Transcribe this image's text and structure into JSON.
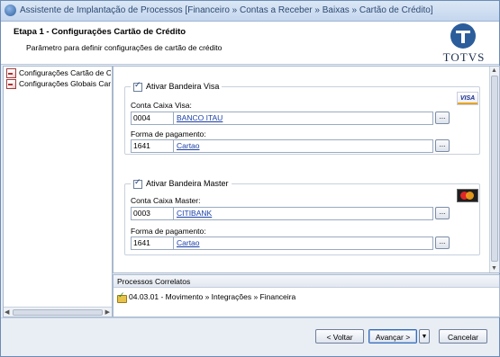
{
  "window": {
    "title": "Assistente de Implantação de Processos [Financeiro » Contas a Receber » Baixas » Cartão de Crédito]"
  },
  "header": {
    "step": "Etapa 1 - Configurações Cartão de Crédito",
    "subtitle": "Parâmetro para definir configurações de cartão de crédito",
    "logo_text": "TOTVS"
  },
  "tree": {
    "items": [
      {
        "label": "Configurações Cartão de Crédito"
      },
      {
        "label": "Configurações Globais Cartão"
      }
    ]
  },
  "visa": {
    "checkbox_label": "Ativar Bandeira Visa",
    "checked": true,
    "brand_icon": "visa-card-icon",
    "account_label": "Conta Caixa Visa:",
    "account_code": "0004",
    "account_desc": "BANCO ITAU",
    "payment_label": "Forma de pagamento:",
    "payment_code": "1641",
    "payment_desc": "Cartao",
    "lookup_label": "..."
  },
  "master": {
    "checkbox_label": "Ativar Bandeira Master",
    "checked": true,
    "brand_icon": "mastercard-icon",
    "account_label": "Conta Caixa Master:",
    "account_code": "0003",
    "account_desc": "CITIBANK",
    "payment_label": "Forma de pagamento:",
    "payment_code": "1641",
    "payment_desc": "Cartao",
    "lookup_label": "..."
  },
  "related": {
    "header": "Processos Correlatos",
    "items": [
      {
        "label": "04.03.01 - Movimento » Integrações » Financeira"
      }
    ]
  },
  "footer": {
    "back_label": "< Voltar",
    "next_label": "Avançar >",
    "cancel_label": "Cancelar"
  },
  "colors": {
    "accent": "#2b5d9b",
    "link": "#1a3fa8"
  }
}
